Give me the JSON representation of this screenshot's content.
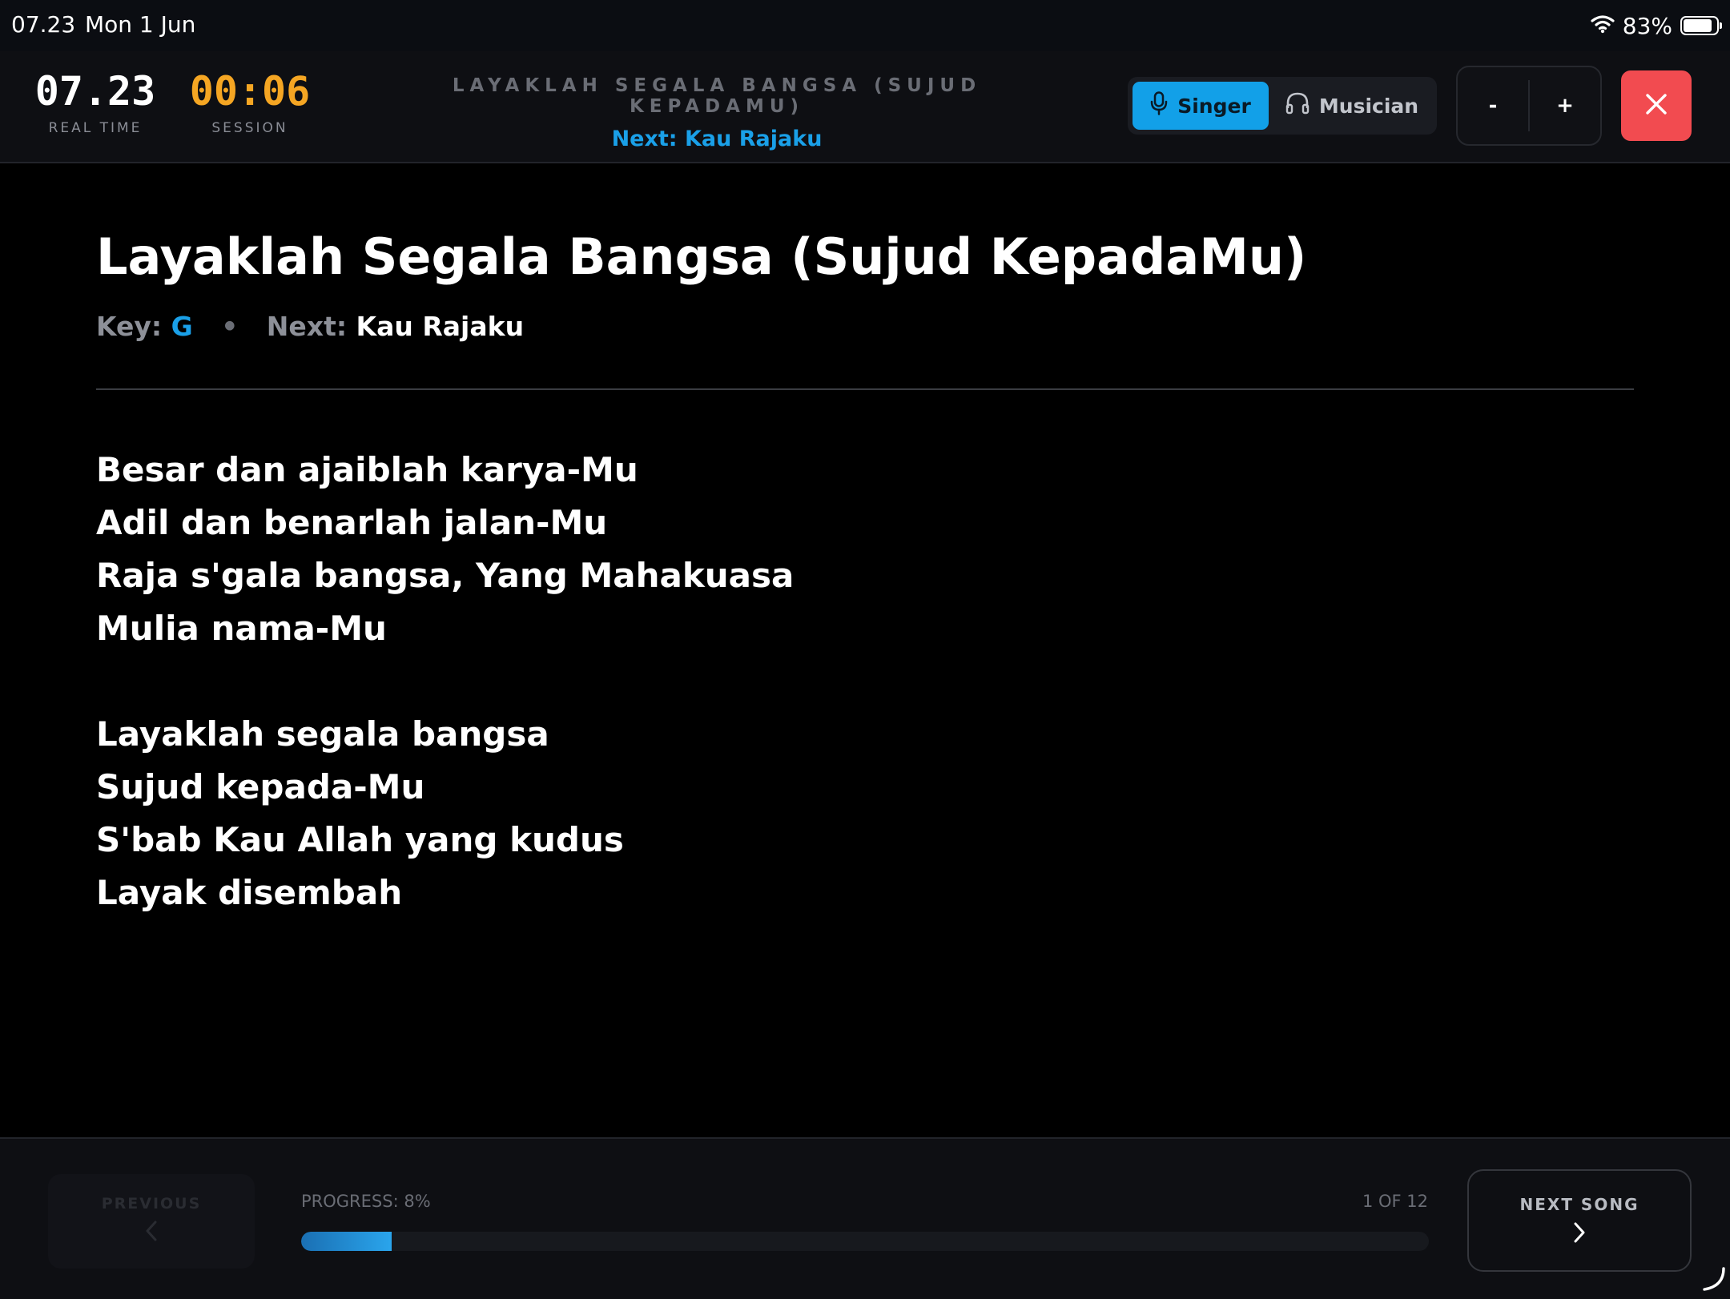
{
  "status_bar": {
    "time": "07.23",
    "date": "Mon 1 Jun",
    "battery_percent": "83%",
    "icons": [
      "wifi-icon",
      "battery-icon"
    ]
  },
  "header": {
    "real_time": {
      "value": "07.23",
      "label": "REAL TIME"
    },
    "session": {
      "value": "00:06",
      "label": "SESSION"
    },
    "song_title": "LAYAKLAH SEGALA BANGSA (SUJUD KEPADAMU)",
    "next_label": "Next: Kau Rajaku",
    "modes": {
      "singer": "Singer",
      "musician": "Musician",
      "active": "singer"
    },
    "zoom": {
      "minus": "-",
      "plus": "+"
    },
    "close_icon": "close-icon"
  },
  "song": {
    "title": "Layaklah Segala Bangsa (Sujud KepadaMu)",
    "key_label": "Key:",
    "key_value": "G",
    "separator": "•",
    "next_label": "Next:",
    "next_value": "Kau Rajaku",
    "stanzas": [
      [
        "Besar dan ajaiblah karya-Mu",
        "Adil dan benarlah jalan-Mu",
        "Raja s'gala bangsa, Yang Mahakuasa",
        "Mulia nama-Mu"
      ],
      [
        "Layaklah segala bangsa",
        "Sujud kepada-Mu",
        "S'bab Kau Allah yang kudus",
        "Layak disembah"
      ]
    ]
  },
  "footer": {
    "previous_label": "PREVIOUS",
    "progress_label": "PROGRESS: 8%",
    "progress_fraction": 0.08,
    "count_label": "1 OF 12",
    "next_song_label": "NEXT SONG"
  },
  "colors": {
    "accent_blue": "#1aa0e8",
    "session_orange": "#f5a623",
    "close_red": "#f24b50",
    "background": "#000000"
  }
}
